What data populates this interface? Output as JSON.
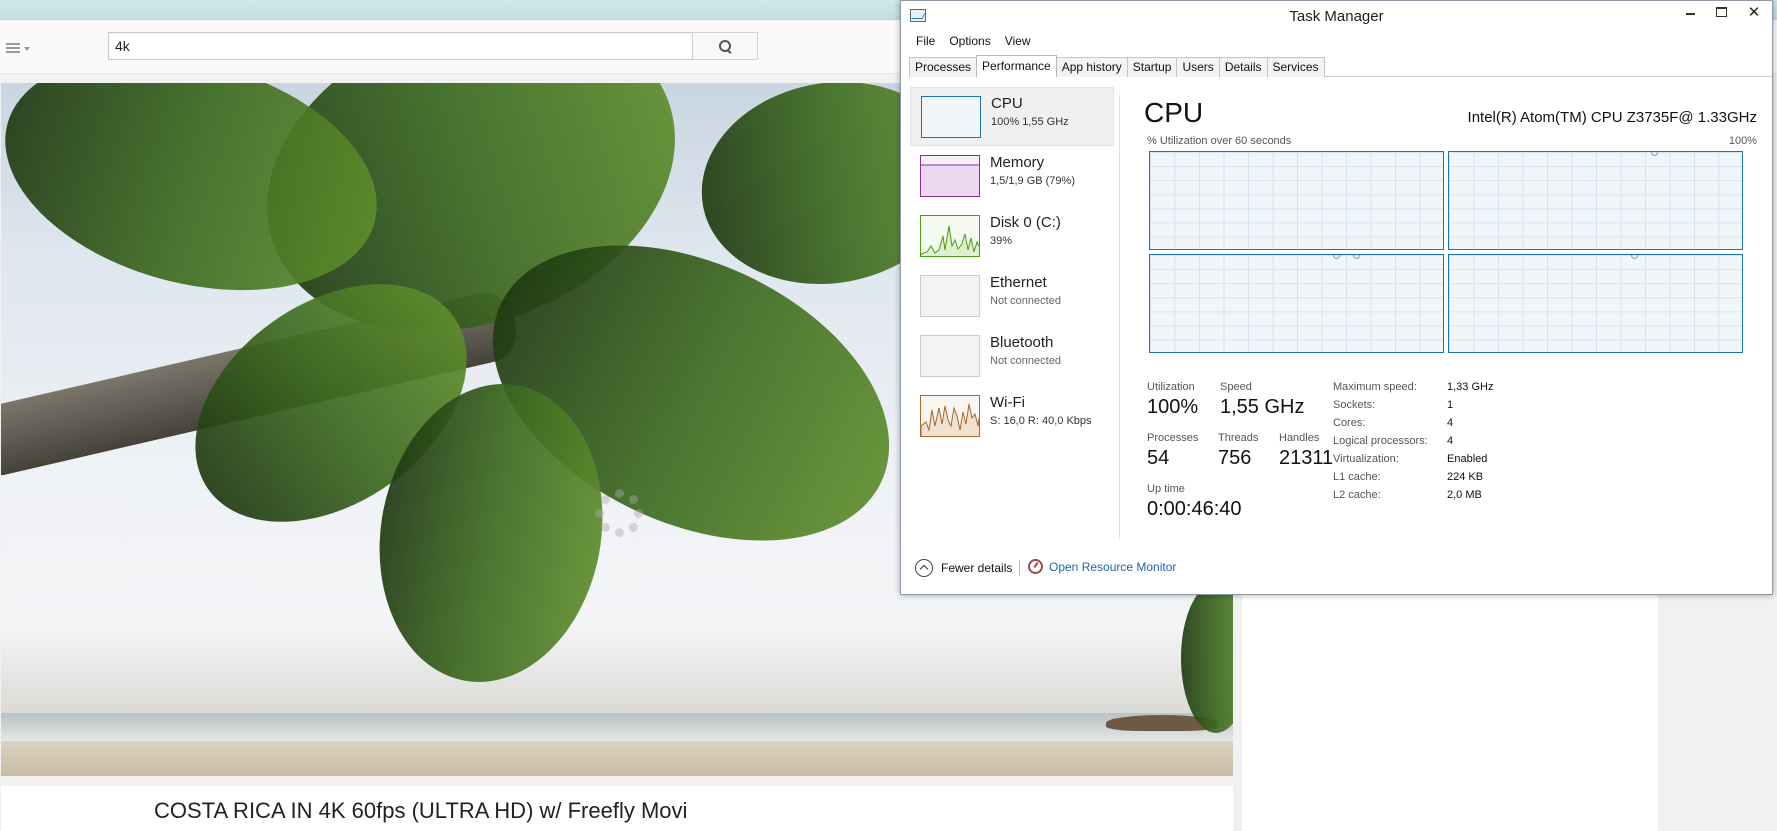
{
  "browser": {
    "search": {
      "value": "4k"
    },
    "video": {
      "title": "COSTA RICA IN 4K 60fps (ULTRA HD) w/ Freefly Movi"
    }
  },
  "task_manager": {
    "title": "Task Manager",
    "window_buttons": {
      "close": "✕"
    },
    "menu": [
      "File",
      "Options",
      "View"
    ],
    "tabs": [
      {
        "label": "Processes",
        "active": false
      },
      {
        "label": "Performance",
        "active": true
      },
      {
        "label": "App history",
        "active": false
      },
      {
        "label": "Startup",
        "active": false
      },
      {
        "label": "Users",
        "active": false
      },
      {
        "label": "Details",
        "active": false
      },
      {
        "label": "Services",
        "active": false
      }
    ],
    "resources": [
      {
        "name": "CPU",
        "detail": "100%  1,55 GHz",
        "color": "#1a74b8",
        "selected": true
      },
      {
        "name": "Memory",
        "detail": "1,5/1,9 GB (79%)",
        "color": "#8b2a9b"
      },
      {
        "name": "Disk 0 (C:)",
        "detail": "39%",
        "color": "#4d9a14"
      },
      {
        "name": "Ethernet",
        "detail": "Not connected",
        "color": "#a7672d"
      },
      {
        "name": "Bluetooth",
        "detail": "Not connected",
        "color": "#a7672d"
      },
      {
        "name": "Wi-Fi",
        "detail_send": "S: 16,0",
        "detail_receive": "R: 40,0 Kbps",
        "color": "#a7672d"
      }
    ],
    "cpu": {
      "heading": "CPU",
      "model": "Intel(R) Atom(TM) CPU Z3735F@ 1.33GHz",
      "graph_label": "% Utilization over 60 seconds",
      "graph_max": "100%",
      "stats": {
        "utilization_label": "Utilization",
        "utilization": "100%",
        "speed_label": "Speed",
        "speed": "1,55 GHz",
        "processes_label": "Processes",
        "processes": "54",
        "threads_label": "Threads",
        "threads": "756",
        "handles_label": "Handles",
        "handles": "21311",
        "uptime_label": "Up time",
        "uptime": "0:00:46:40"
      },
      "specs": [
        {
          "label": "Maximum speed:",
          "value": "1,33 GHz"
        },
        {
          "label": "Sockets:",
          "value": "1"
        },
        {
          "label": "Cores:",
          "value": "4"
        },
        {
          "label": "Logical processors:",
          "value": "4"
        },
        {
          "label": "Virtualization:",
          "value": "Enabled"
        },
        {
          "label": "L1 cache:",
          "value": "224 KB"
        },
        {
          "label": "L2 cache:",
          "value": "2,0 MB"
        }
      ]
    },
    "footer": {
      "fewer_details": "Fewer details",
      "open_resource_monitor": "Open Resource Monitor"
    }
  }
}
